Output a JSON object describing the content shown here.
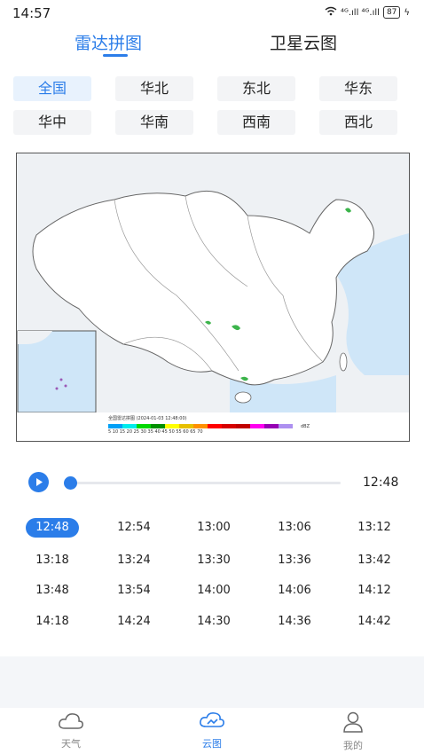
{
  "status_bar": {
    "time": "14:57",
    "network": "⁴ᴳ.ıll ⁴ᴳ.ıll",
    "battery": "87"
  },
  "tabs": [
    {
      "label": "雷达拼图"
    },
    {
      "label": "卫星云图"
    }
  ],
  "regions": [
    "全国",
    "华北",
    "东北",
    "华东",
    "华中",
    "华南",
    "西南",
    "西北"
  ],
  "player": {
    "current_time": "12:48",
    "progress": 0.0
  },
  "times": [
    "12:48",
    "12:54",
    "13:00",
    "13:06",
    "13:12",
    "13:18",
    "13:24",
    "13:30",
    "13:36",
    "13:42",
    "13:48",
    "13:54",
    "14:00",
    "14:06",
    "14:12",
    "14:18",
    "14:24",
    "14:30",
    "14:36",
    "14:42"
  ],
  "map_legend": {
    "title": "全国雷达拼图 (2024-01-03 12:48:00)",
    "unit": "dBZ",
    "scale": "5 10 15 20 25 30 35 40 45 50 55 60 65 70"
  },
  "colors": {
    "accent": "#2b7de9"
  },
  "nav": [
    {
      "label": "天气",
      "icon": "cloud-icon"
    },
    {
      "label": "云图",
      "icon": "cloud-radar-icon"
    },
    {
      "label": "我的",
      "icon": "user-icon"
    }
  ]
}
